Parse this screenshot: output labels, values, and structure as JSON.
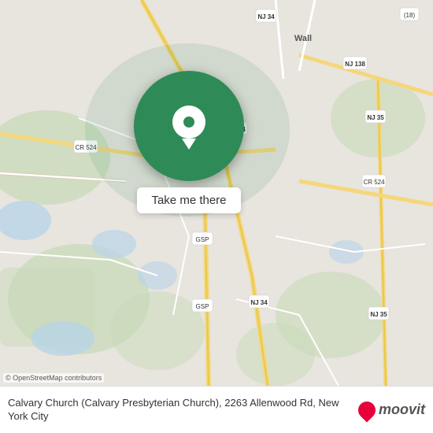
{
  "map": {
    "background_color": "#e8e4de",
    "overlay_color": "rgba(46,139,87,0.15)"
  },
  "popup": {
    "label": "Take me there",
    "circle_color": "#2e8b57",
    "pin_color": "#ffffff",
    "pin_dot_color": "#2e8b57"
  },
  "attribution": {
    "osm_text": "© OpenStreetMap contributors"
  },
  "bottom_bar": {
    "description": "Calvary Church (Calvary Presbyterian Church), 2263 Allenwood Rd, New York City",
    "logo_text": "moovit"
  }
}
